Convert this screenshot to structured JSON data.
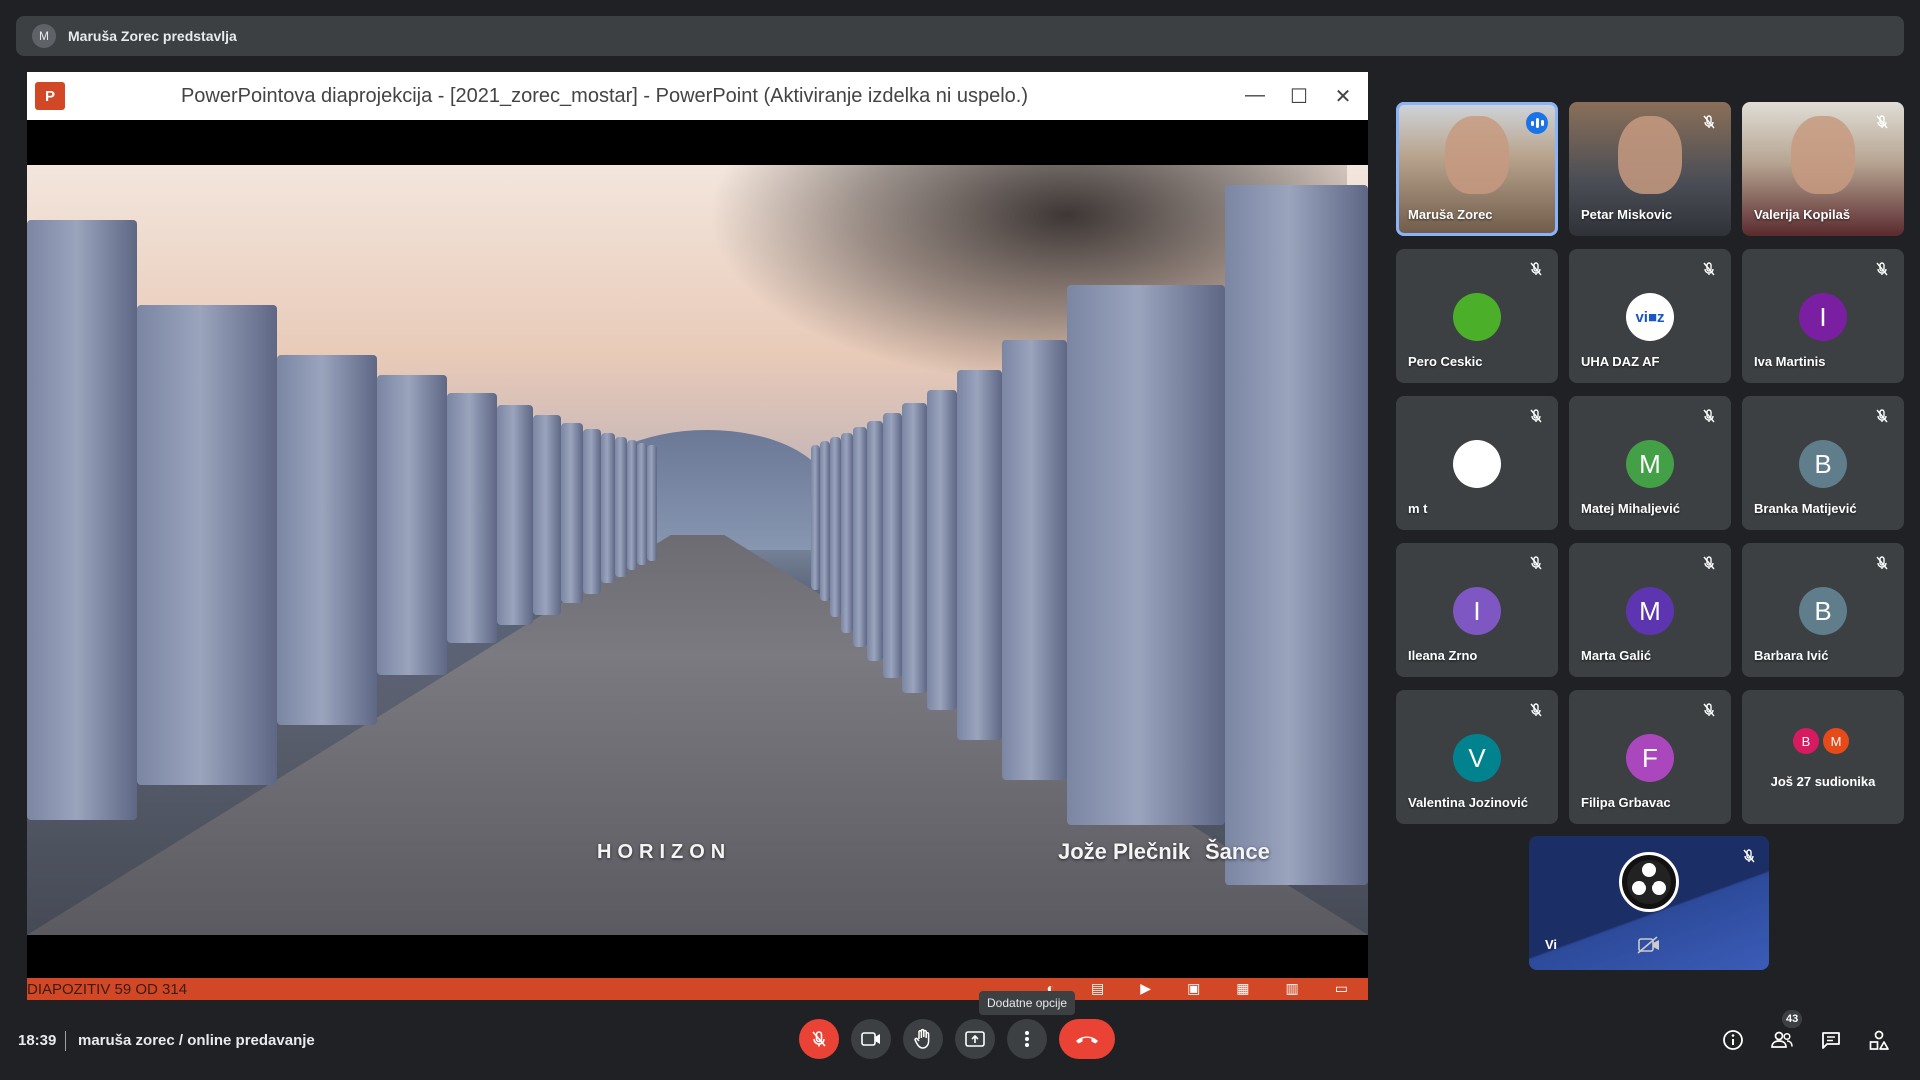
{
  "presenter_bar": {
    "avatar_letter": "M",
    "text": "Maruša Zorec predstavlja"
  },
  "shared_screen": {
    "window_title": "PowerPointova diaprojekcija - [2021_zorec_mostar] - PowerPoint (Aktiviranje izdelka ni uspelo.)",
    "app_logo": "P",
    "window_buttons": {
      "minimize": "—",
      "maximize": "☐",
      "close": "✕"
    },
    "slide": {
      "label_left": "HORIZON",
      "label_author": "Jože Plečnik",
      "label_place": "Šance"
    },
    "status_text": "DIAPOZITIV 59 OD 314"
  },
  "participants": [
    {
      "name": "Maruša Zorec",
      "kind": "video",
      "speaking": true
    },
    {
      "name": "Petar Miskovic",
      "kind": "video",
      "muted": true
    },
    {
      "name": "Valerija Kopilaš",
      "kind": "video",
      "muted": true
    },
    {
      "name": "Pero Ceskic",
      "kind": "avatar",
      "avatar_text": "",
      "avatar_color": "#4caf2a",
      "muted": true
    },
    {
      "name": "UHA DAZ AF",
      "kind": "avatar",
      "avatar_text": "vi■z",
      "avatar_color": "#ffffff",
      "muted": true
    },
    {
      "name": "Iva Martinis",
      "kind": "avatar",
      "avatar_text": "I",
      "avatar_color": "#7b1fa2",
      "muted": true
    },
    {
      "name": "m t",
      "kind": "avatar",
      "avatar_text": "",
      "avatar_color": "#ffffff",
      "muted": true
    },
    {
      "name": "Matej Mihaljević",
      "kind": "avatar",
      "avatar_text": "M",
      "avatar_color": "#43a047",
      "muted": true
    },
    {
      "name": "Branka Matijević",
      "kind": "avatar",
      "avatar_text": "B",
      "avatar_color": "#607d8b",
      "muted": true
    },
    {
      "name": "Ileana Zrno",
      "kind": "avatar",
      "avatar_text": "I",
      "avatar_color": "#7e57c2",
      "muted": true
    },
    {
      "name": "Marta Galić",
      "kind": "avatar",
      "avatar_text": "M",
      "avatar_color": "#5e35b1",
      "muted": true
    },
    {
      "name": "Barbara Ivić",
      "kind": "avatar",
      "avatar_text": "B",
      "avatar_color": "#607d8b",
      "muted": true
    },
    {
      "name": "Valentina Jozinović",
      "kind": "avatar",
      "avatar_text": "V",
      "avatar_color": "#00838f",
      "muted": true
    },
    {
      "name": "Filipa Grbavac",
      "kind": "avatar",
      "avatar_text": "F",
      "avatar_color": "#ab47bc",
      "muted": true
    }
  ],
  "more_participants": {
    "label": "Još 27 sudionika",
    "avatars": [
      {
        "letter": "B",
        "color": "#d81b60"
      },
      {
        "letter": "M",
        "color": "#e64a19"
      }
    ]
  },
  "self_view": {
    "name": "Vi"
  },
  "bottom_bar": {
    "time": "18:39",
    "meeting_name": "maruša zorec / online predavanje",
    "tooltip": "Dodatne opcije",
    "participant_count": "43"
  },
  "colors": {
    "danger": "#ea4335",
    "accent": "#8ab4f8",
    "ppt_orange": "#d24726"
  }
}
